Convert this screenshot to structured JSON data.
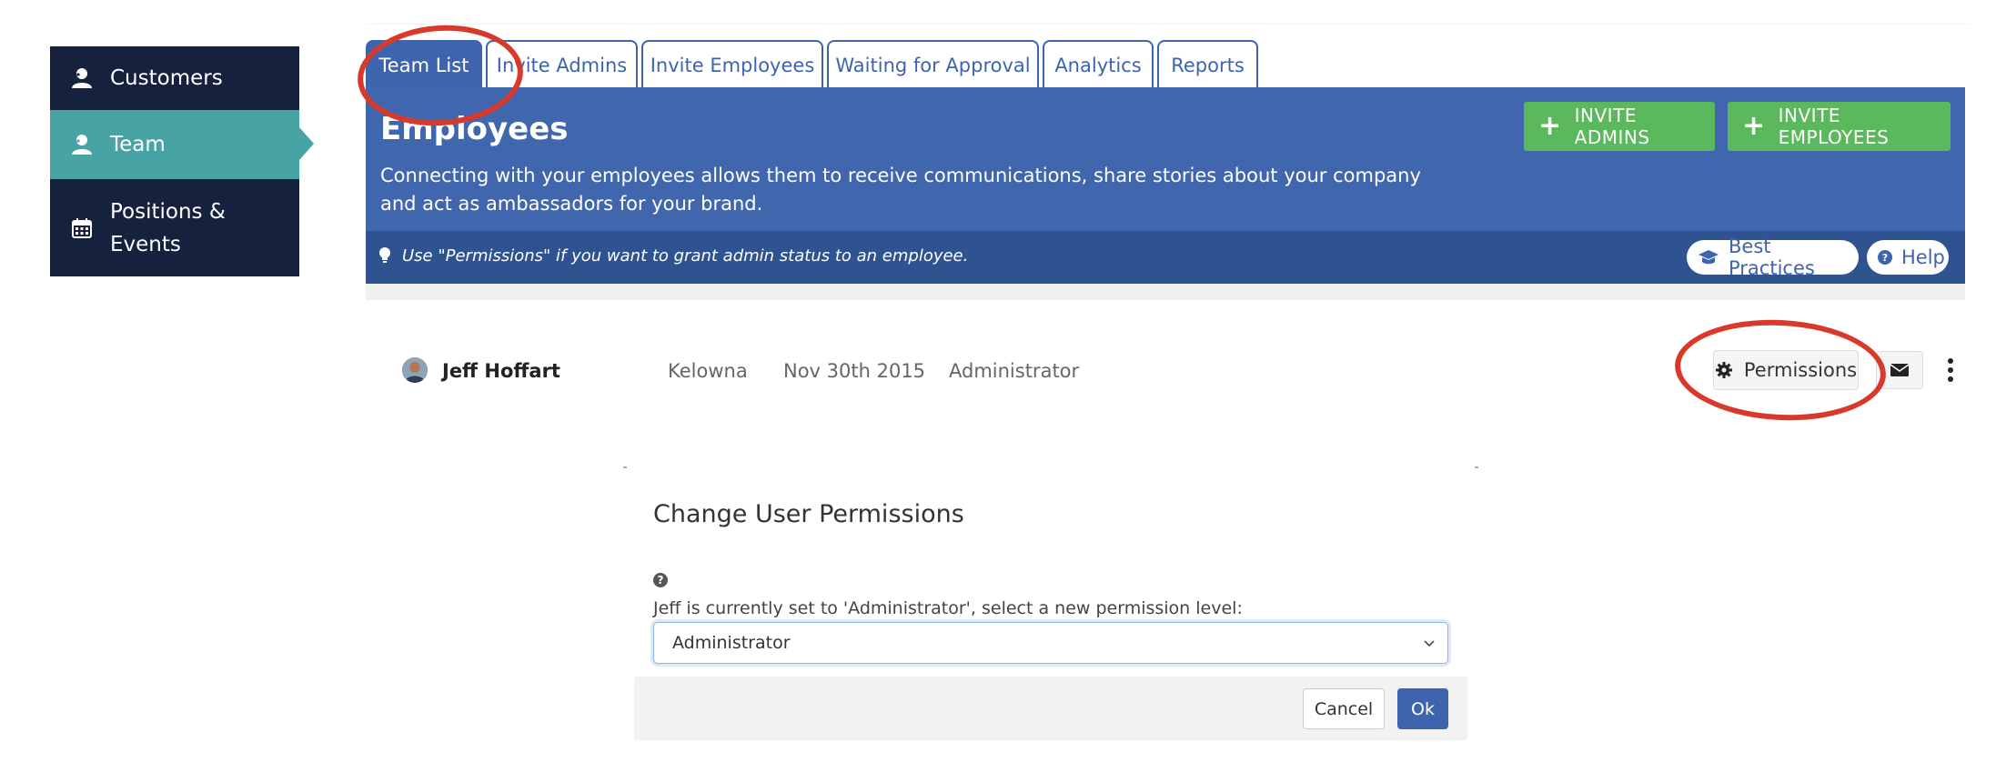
{
  "colors": {
    "sidebar_bg": "#16213e",
    "sidebar_active": "#48a3a5",
    "brand_blue": "#3e64ad",
    "banner_bg": "#4066ae",
    "tip_bar_bg": "#2f5291",
    "green_button": "#5cb85c",
    "annotation_red": "#d8392b"
  },
  "sidebar": {
    "items": [
      {
        "label": "Customers",
        "icon": "user-icon",
        "active": false
      },
      {
        "label": "Team",
        "icon": "user-icon",
        "active": true
      },
      {
        "label": "Positions & Events",
        "icon": "calendar-icon",
        "active": false
      }
    ]
  },
  "tabs": [
    {
      "label": "Team List",
      "active": true
    },
    {
      "label": "Invite Admins",
      "active": false
    },
    {
      "label": "Invite Employees",
      "active": false
    },
    {
      "label": "Waiting for Approval",
      "active": false
    },
    {
      "label": "Analytics",
      "active": false
    },
    {
      "label": "Reports",
      "active": false
    }
  ],
  "banner": {
    "title": "Employees",
    "description": "Connecting with your employees allows them to receive communications, share stories about your company and act as ambassadors for your brand.",
    "invite_admins_button": "INVITE ADMINS",
    "invite_employees_button": "INVITE EMPLOYEES",
    "tip": "Use \"Permissions\" if you want to grant admin status to an employee.",
    "best_practices_button": "Best Practices",
    "help_button": "Help"
  },
  "employee_row": {
    "name": "Jeff Hoffart",
    "location": "Kelowna",
    "date": "Nov 30th 2015",
    "role": "Administrator",
    "permissions_button": "Permissions"
  },
  "dialog": {
    "title": "Change User Permissions",
    "label": "Jeff is currently set to 'Administrator', select a new permission level:",
    "selected": "Administrator",
    "cancel_button": "Cancel",
    "ok_button": "Ok"
  }
}
